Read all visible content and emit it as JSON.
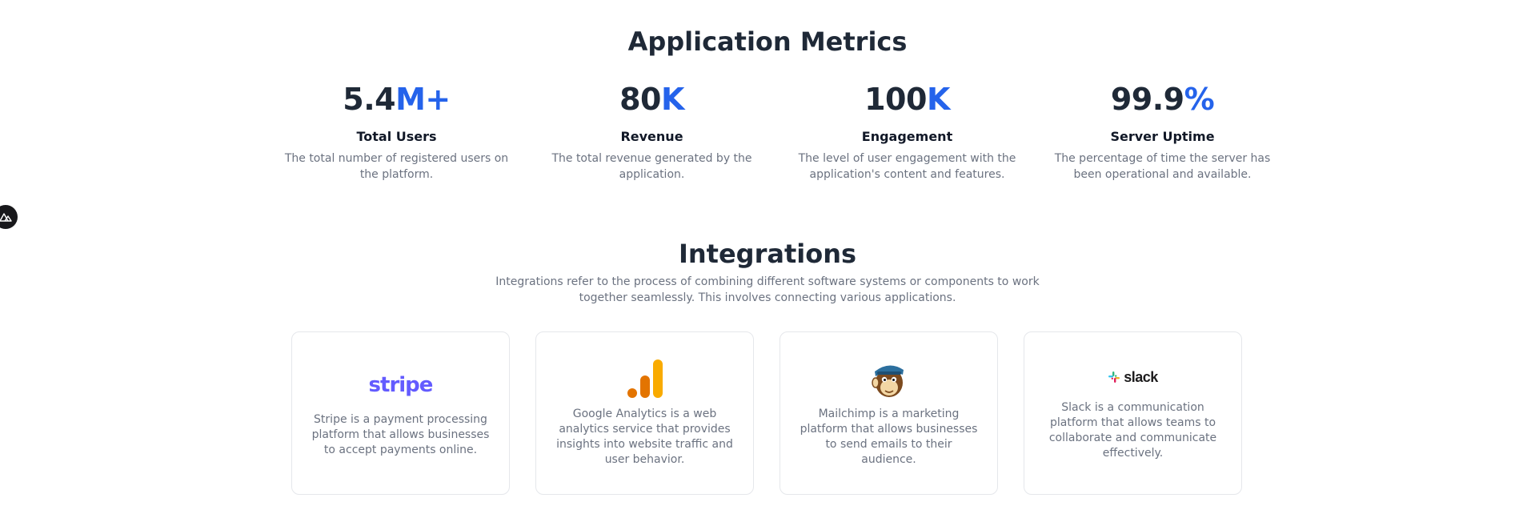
{
  "metrics": {
    "title": "Application Metrics",
    "items": [
      {
        "value": "5.4",
        "suffix": "M+",
        "label": "Total Users",
        "desc": "The total number of registered users on the platform."
      },
      {
        "value": "80",
        "suffix": "K",
        "label": "Revenue",
        "desc": "The total revenue generated by the application."
      },
      {
        "value": "100",
        "suffix": "K",
        "label": "Engagement",
        "desc": "The level of user engagement with the application's content and features."
      },
      {
        "value": "99.9",
        "suffix": "%",
        "label": "Server Uptime",
        "desc": "The percentage of time the server has been operational and available."
      }
    ]
  },
  "integrations": {
    "title": "Integrations",
    "subtitle": "Integrations refer to the process of combining different software systems or components to work together seamlessly. This involves connecting various applications.",
    "cards": [
      {
        "logo_text": "stripe",
        "icon": "stripe-logo",
        "desc": "Stripe is a payment processing platform that allows businesses to accept payments online."
      },
      {
        "logo_text": "",
        "icon": "google-analytics-logo",
        "desc": "Google Analytics is a web analytics service that provides insights into website traffic and user behavior."
      },
      {
        "logo_text": "",
        "icon": "mailchimp-logo",
        "desc": "Mailchimp is a marketing platform that allows businesses to send emails to their audience."
      },
      {
        "logo_text": "slack",
        "icon": "slack-logo",
        "desc": "Slack is a communication platform that allows teams to collaborate and communicate effectively."
      }
    ]
  },
  "colors": {
    "accent": "#2563eb",
    "stripe": "#635bff",
    "analytics_orange": "#f9ab00",
    "analytics_dark": "#e37400"
  },
  "side_button": {
    "icon": "nuxt-icon"
  }
}
